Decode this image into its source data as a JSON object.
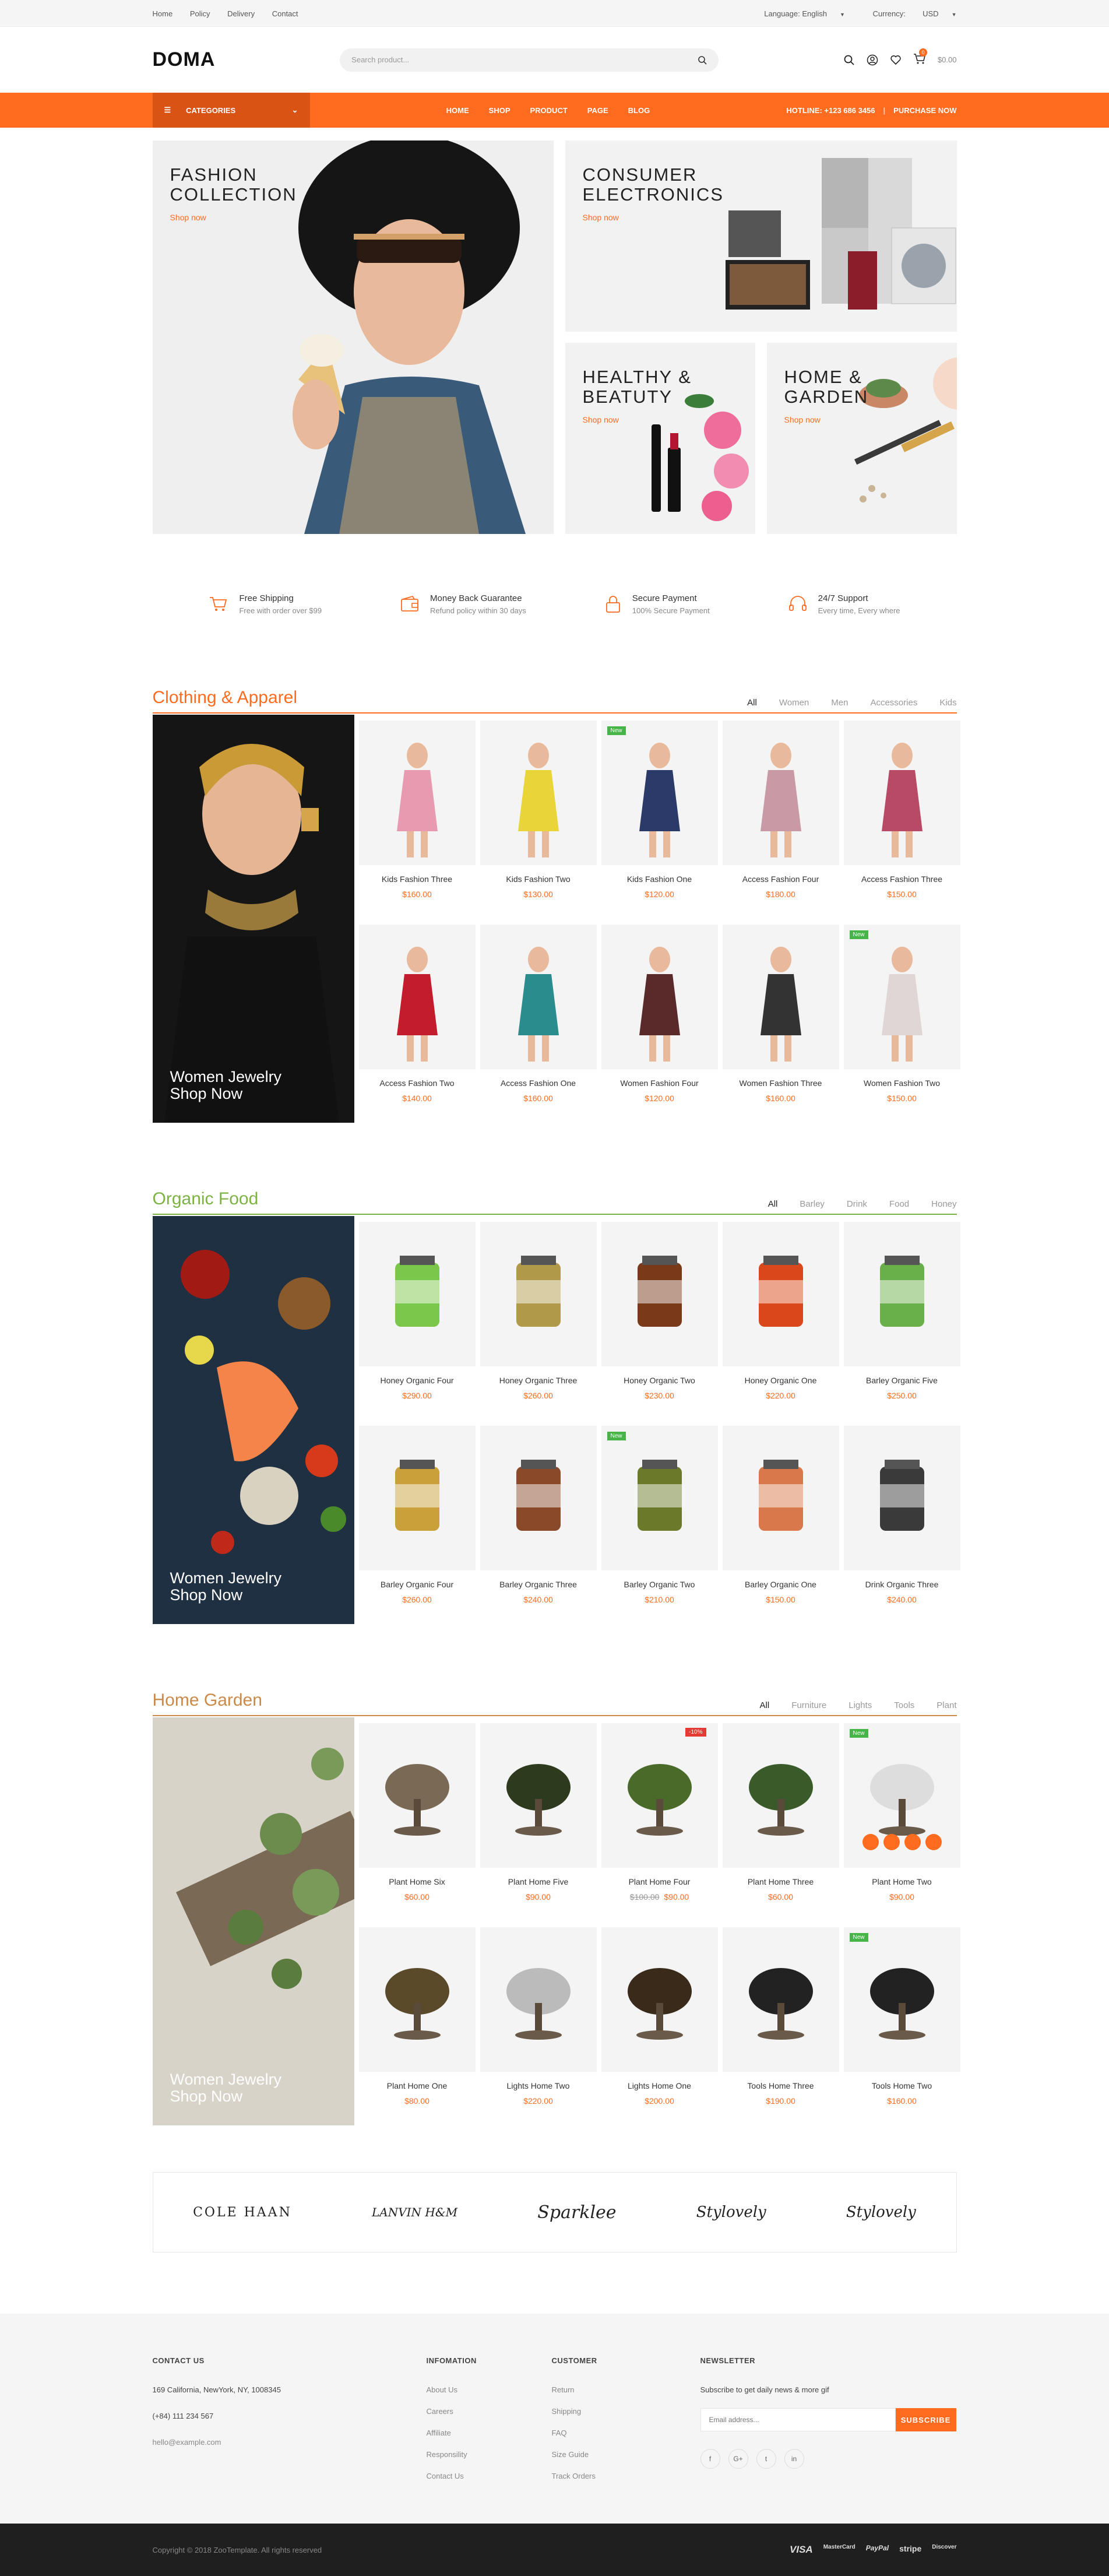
{
  "topbar": {
    "links": [
      "Home",
      "Policy",
      "Delivery",
      "Contact"
    ],
    "language": "Language: English",
    "currency": "Currency:",
    "currency_value": "USD"
  },
  "header": {
    "logo": "DOMA",
    "search_placeholder": "Search product...",
    "cart_total": "$0.00",
    "cart_count": "0"
  },
  "nav": {
    "categories": "CATEGORIES",
    "menu": [
      "HOME",
      "SHOP",
      "PRODUCT",
      "PAGE",
      "BLOG"
    ],
    "hotline": "HOTLINE: +123 686 3456",
    "purchase": "PURCHASE NOW"
  },
  "banners": [
    {
      "title1": "FASHION",
      "title2": "COLLECTION",
      "cta": "Shop now"
    },
    {
      "title1": "CONSUMER",
      "title2": "ELECTRONICS",
      "cta": "Shop now"
    },
    {
      "title1": "HEALTHY &",
      "title2": "BEATUTY",
      "cta": "Shop now"
    },
    {
      "title1": "HOME &",
      "title2": "GARDEN",
      "cta": "Shop now"
    }
  ],
  "services": [
    {
      "title": "Free Shipping",
      "desc": "Free with order over $99"
    },
    {
      "title": "Money Back Guarantee",
      "desc": "Refund policy within 30 days"
    },
    {
      "title": "Secure Payment",
      "desc": "100% Secure Payment"
    },
    {
      "title": "24/7 Support",
      "desc": "Every time, Every where"
    }
  ],
  "sections": [
    {
      "title": "Clothing & Apparel",
      "color": "#ff6b1f",
      "tabs": [
        "All",
        "Women",
        "Men",
        "Accessories",
        "Kids"
      ],
      "banner": [
        "Women Jewelry",
        "Shop Now"
      ],
      "products": [
        {
          "name": "Kids Fashion Three",
          "price": "$160.00"
        },
        {
          "name": "Kids Fashion Two",
          "price": "$130.00"
        },
        {
          "name": "Kids Fashion One",
          "price": "$120.00",
          "tag": "New"
        },
        {
          "name": "Access Fashion Four",
          "price": "$180.00"
        },
        {
          "name": "Access Fashion Three",
          "price": "$150.00"
        },
        {
          "name": "Access Fashion Two",
          "price": "$140.00"
        },
        {
          "name": "Access Fashion One",
          "price": "$160.00"
        },
        {
          "name": "Women Fashion Four",
          "price": "$120.00"
        },
        {
          "name": "Women Fashion Three",
          "price": "$160.00"
        },
        {
          "name": "Women Fashion Two",
          "price": "$150.00",
          "tag": "New"
        }
      ]
    },
    {
      "title": "Organic Food",
      "color": "#7cb342",
      "tabs": [
        "All",
        "Barley",
        "Drink",
        "Food",
        "Honey"
      ],
      "banner": [
        "Women Jewelry",
        "Shop Now"
      ],
      "products": [
        {
          "name": "Honey Organic Four",
          "price": "$290.00"
        },
        {
          "name": "Honey Organic Three",
          "price": "$260.00"
        },
        {
          "name": "Honey Organic Two",
          "price": "$230.00"
        },
        {
          "name": "Honey Organic One",
          "price": "$220.00"
        },
        {
          "name": "Barley Organic Five",
          "price": "$250.00"
        },
        {
          "name": "Barley Organic Four",
          "price": "$260.00"
        },
        {
          "name": "Barley Organic Three",
          "price": "$240.00"
        },
        {
          "name": "Barley Organic Two",
          "price": "$210.00",
          "tag": "New"
        },
        {
          "name": "Barley Organic One",
          "price": "$150.00"
        },
        {
          "name": "Drink Organic Three",
          "price": "$240.00"
        }
      ]
    },
    {
      "title": "Home Garden",
      "color": "#c98a4b",
      "tabs": [
        "All",
        "Furniture",
        "Lights",
        "Tools",
        "Plant"
      ],
      "banner": [
        "Women Jewelry",
        "Shop Now"
      ],
      "products": [
        {
          "name": "Plant Home Six",
          "price": "$60.00"
        },
        {
          "name": "Plant Home Five",
          "price": "$90.00"
        },
        {
          "name": "Plant Home Four",
          "price": "$90.00",
          "old": "$100.00",
          "sale": "-10%"
        },
        {
          "name": "Plant Home Three",
          "price": "$60.00"
        },
        {
          "name": "Plant Home Two",
          "price": "$90.00",
          "tag": "New"
        },
        {
          "name": "Plant Home One",
          "price": "$80.00"
        },
        {
          "name": "Lights Home Two",
          "price": "$220.00"
        },
        {
          "name": "Lights Home One",
          "price": "$200.00"
        },
        {
          "name": "Tools Home Three",
          "price": "$190.00"
        },
        {
          "name": "Tools Home Two",
          "price": "$160.00",
          "tag": "New"
        }
      ]
    }
  ],
  "brands": [
    "COLE HAAN",
    "LANVIN H&M",
    "Sparklee",
    "Stylovely",
    "Stylovely"
  ],
  "footer": {
    "contact": {
      "title": "CONTACT US",
      "address": "169 California, NewYork, NY, 1008345",
      "phone": "(+84) 111 234 567",
      "email": "hello@example.com"
    },
    "info": {
      "title": "INFOMATION",
      "items": [
        "About Us",
        "Careers",
        "Affiliate",
        "Responsility",
        "Contact Us"
      ]
    },
    "customer": {
      "title": "CUSTOMER",
      "items": [
        "Return",
        "Shipping",
        "FAQ",
        "Size Guide",
        "Track Orders"
      ]
    },
    "newsletter": {
      "title": "NEWSLETTER",
      "desc": "Subscribe to get daily news & more gif",
      "placeholder": "Email address...",
      "button": "SUBSCRIBE",
      "social": [
        "f",
        "G+",
        "t",
        "in"
      ]
    }
  },
  "copyright": "Copyright © 2018 ZooTemplate. All rights reserved",
  "payments": [
    "VISA",
    "MasterCard",
    "PayPal",
    "stripe",
    "Discover"
  ]
}
